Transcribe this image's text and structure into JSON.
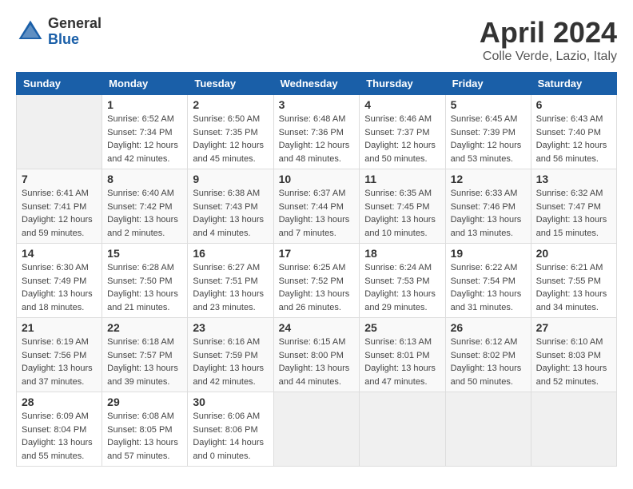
{
  "header": {
    "logo": {
      "general": "General",
      "blue": "Blue"
    },
    "title": "April 2024",
    "location": "Colle Verde, Lazio, Italy"
  },
  "weekdays": [
    "Sunday",
    "Monday",
    "Tuesday",
    "Wednesday",
    "Thursday",
    "Friday",
    "Saturday"
  ],
  "weeks": [
    [
      {
        "day": "",
        "info": ""
      },
      {
        "day": "1",
        "info": "Sunrise: 6:52 AM\nSunset: 7:34 PM\nDaylight: 12 hours\nand 42 minutes."
      },
      {
        "day": "2",
        "info": "Sunrise: 6:50 AM\nSunset: 7:35 PM\nDaylight: 12 hours\nand 45 minutes."
      },
      {
        "day": "3",
        "info": "Sunrise: 6:48 AM\nSunset: 7:36 PM\nDaylight: 12 hours\nand 48 minutes."
      },
      {
        "day": "4",
        "info": "Sunrise: 6:46 AM\nSunset: 7:37 PM\nDaylight: 12 hours\nand 50 minutes."
      },
      {
        "day": "5",
        "info": "Sunrise: 6:45 AM\nSunset: 7:39 PM\nDaylight: 12 hours\nand 53 minutes."
      },
      {
        "day": "6",
        "info": "Sunrise: 6:43 AM\nSunset: 7:40 PM\nDaylight: 12 hours\nand 56 minutes."
      }
    ],
    [
      {
        "day": "7",
        "info": "Sunrise: 6:41 AM\nSunset: 7:41 PM\nDaylight: 12 hours\nand 59 minutes."
      },
      {
        "day": "8",
        "info": "Sunrise: 6:40 AM\nSunset: 7:42 PM\nDaylight: 13 hours\nand 2 minutes."
      },
      {
        "day": "9",
        "info": "Sunrise: 6:38 AM\nSunset: 7:43 PM\nDaylight: 13 hours\nand 4 minutes."
      },
      {
        "day": "10",
        "info": "Sunrise: 6:37 AM\nSunset: 7:44 PM\nDaylight: 13 hours\nand 7 minutes."
      },
      {
        "day": "11",
        "info": "Sunrise: 6:35 AM\nSunset: 7:45 PM\nDaylight: 13 hours\nand 10 minutes."
      },
      {
        "day": "12",
        "info": "Sunrise: 6:33 AM\nSunset: 7:46 PM\nDaylight: 13 hours\nand 13 minutes."
      },
      {
        "day": "13",
        "info": "Sunrise: 6:32 AM\nSunset: 7:47 PM\nDaylight: 13 hours\nand 15 minutes."
      }
    ],
    [
      {
        "day": "14",
        "info": "Sunrise: 6:30 AM\nSunset: 7:49 PM\nDaylight: 13 hours\nand 18 minutes."
      },
      {
        "day": "15",
        "info": "Sunrise: 6:28 AM\nSunset: 7:50 PM\nDaylight: 13 hours\nand 21 minutes."
      },
      {
        "day": "16",
        "info": "Sunrise: 6:27 AM\nSunset: 7:51 PM\nDaylight: 13 hours\nand 23 minutes."
      },
      {
        "day": "17",
        "info": "Sunrise: 6:25 AM\nSunset: 7:52 PM\nDaylight: 13 hours\nand 26 minutes."
      },
      {
        "day": "18",
        "info": "Sunrise: 6:24 AM\nSunset: 7:53 PM\nDaylight: 13 hours\nand 29 minutes."
      },
      {
        "day": "19",
        "info": "Sunrise: 6:22 AM\nSunset: 7:54 PM\nDaylight: 13 hours\nand 31 minutes."
      },
      {
        "day": "20",
        "info": "Sunrise: 6:21 AM\nSunset: 7:55 PM\nDaylight: 13 hours\nand 34 minutes."
      }
    ],
    [
      {
        "day": "21",
        "info": "Sunrise: 6:19 AM\nSunset: 7:56 PM\nDaylight: 13 hours\nand 37 minutes."
      },
      {
        "day": "22",
        "info": "Sunrise: 6:18 AM\nSunset: 7:57 PM\nDaylight: 13 hours\nand 39 minutes."
      },
      {
        "day": "23",
        "info": "Sunrise: 6:16 AM\nSunset: 7:59 PM\nDaylight: 13 hours\nand 42 minutes."
      },
      {
        "day": "24",
        "info": "Sunrise: 6:15 AM\nSunset: 8:00 PM\nDaylight: 13 hours\nand 44 minutes."
      },
      {
        "day": "25",
        "info": "Sunrise: 6:13 AM\nSunset: 8:01 PM\nDaylight: 13 hours\nand 47 minutes."
      },
      {
        "day": "26",
        "info": "Sunrise: 6:12 AM\nSunset: 8:02 PM\nDaylight: 13 hours\nand 50 minutes."
      },
      {
        "day": "27",
        "info": "Sunrise: 6:10 AM\nSunset: 8:03 PM\nDaylight: 13 hours\nand 52 minutes."
      }
    ],
    [
      {
        "day": "28",
        "info": "Sunrise: 6:09 AM\nSunset: 8:04 PM\nDaylight: 13 hours\nand 55 minutes."
      },
      {
        "day": "29",
        "info": "Sunrise: 6:08 AM\nSunset: 8:05 PM\nDaylight: 13 hours\nand 57 minutes."
      },
      {
        "day": "30",
        "info": "Sunrise: 6:06 AM\nSunset: 8:06 PM\nDaylight: 14 hours\nand 0 minutes."
      },
      {
        "day": "",
        "info": ""
      },
      {
        "day": "",
        "info": ""
      },
      {
        "day": "",
        "info": ""
      },
      {
        "day": "",
        "info": ""
      }
    ]
  ]
}
